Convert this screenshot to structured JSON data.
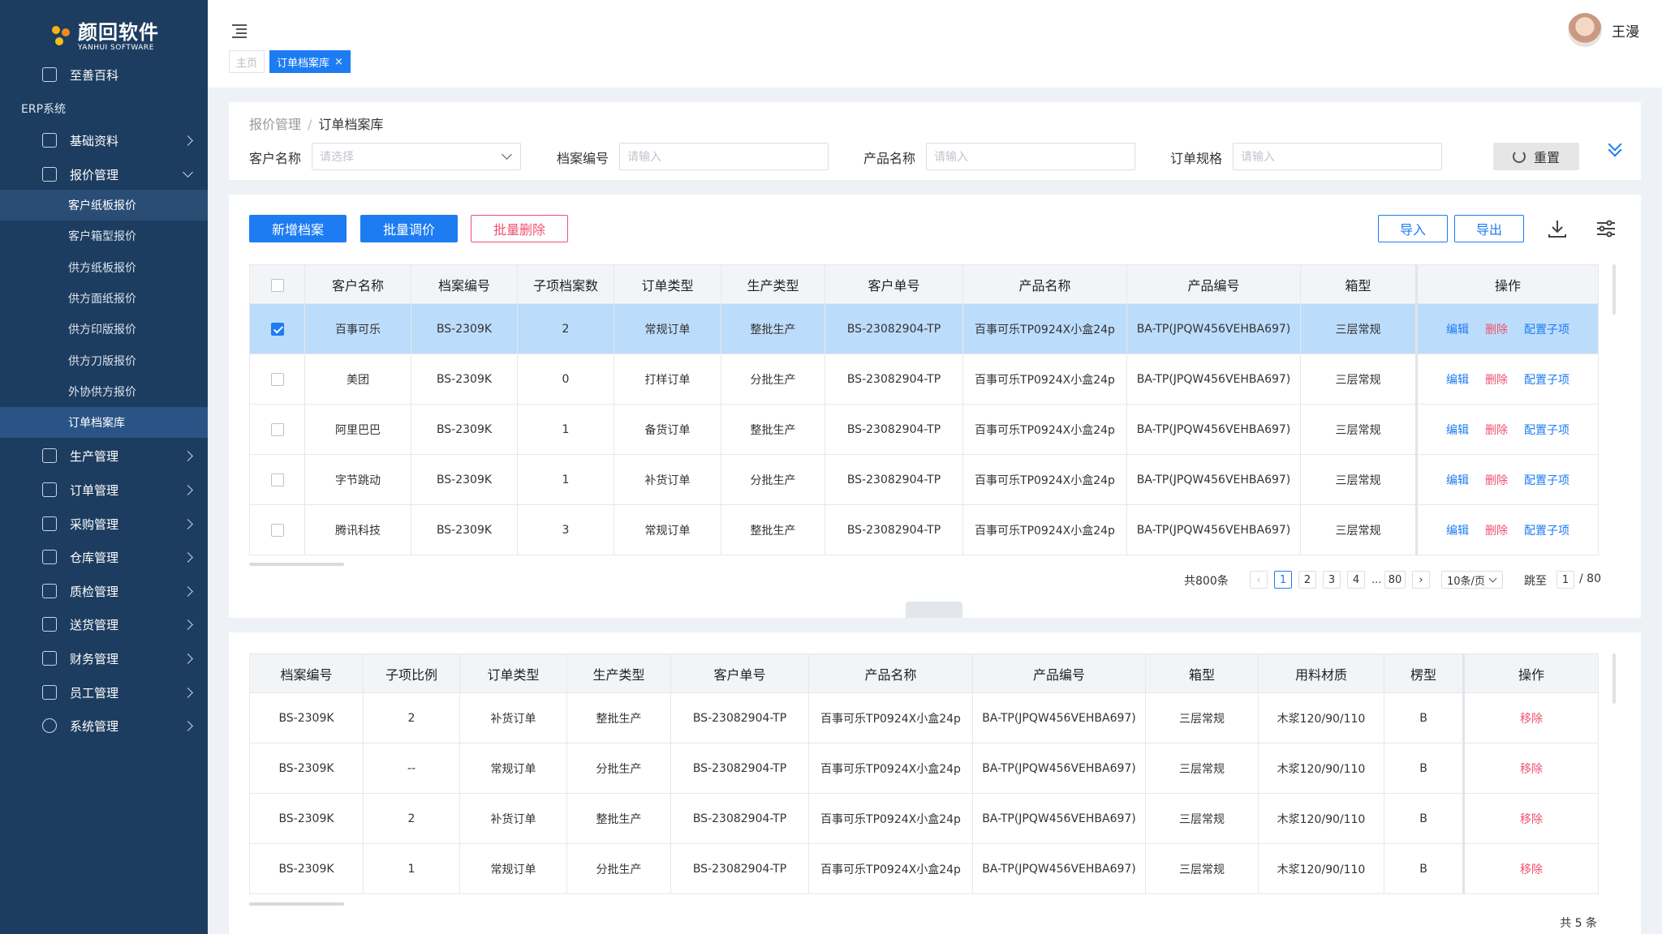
{
  "brand": {
    "name_cn": "颜回软件",
    "name_en": "YANHUI SOFTWARE"
  },
  "sidebar": {
    "top_item": "至善百科",
    "section": "ERP系统",
    "items": [
      {
        "label": "基础资料",
        "icon": "database-icon"
      },
      {
        "label": "报价管理",
        "icon": "quote-icon",
        "expanded": true
      },
      {
        "label": "生产管理",
        "icon": "factory-icon"
      },
      {
        "label": "订单管理",
        "icon": "order-icon"
      },
      {
        "label": "采购管理",
        "icon": "purchase-icon"
      },
      {
        "label": "仓库管理",
        "icon": "warehouse-icon"
      },
      {
        "label": "质检管理",
        "icon": "shield-icon"
      },
      {
        "label": "送货管理",
        "icon": "box-icon"
      },
      {
        "label": "财务管理",
        "icon": "finance-icon"
      },
      {
        "label": "员工管理",
        "icon": "staff-icon"
      },
      {
        "label": "系统管理",
        "icon": "gear-icon"
      }
    ],
    "sub_items": [
      "客户纸板报价",
      "客户箱型报价",
      "供方纸板报价",
      "供方面纸报价",
      "供方印版报价",
      "供方刀版报价",
      "外协供方报价",
      "订单档案库"
    ]
  },
  "header": {
    "tabs": [
      {
        "label": "主页"
      },
      {
        "label": "订单档案库",
        "close": "×"
      }
    ],
    "user_name": "王漫"
  },
  "filter": {
    "breadcrumb": [
      "报价管理",
      "订单档案库"
    ],
    "fields": [
      {
        "label": "客户名称",
        "placeholder": "请选择"
      },
      {
        "label": "档案编号",
        "placeholder": "请输入"
      },
      {
        "label": "产品名称",
        "placeholder": "请输入"
      },
      {
        "label": "订单规格",
        "placeholder": "请输入"
      }
    ],
    "reset": "重置"
  },
  "toolbar": {
    "add": "新增档案",
    "batch_price": "批量调价",
    "batch_delete": "批量删除",
    "import": "导入",
    "export": "导出"
  },
  "table1": {
    "headers": [
      "客户名称",
      "档案编号",
      "子项档案数",
      "订单类型",
      "生产类型",
      "客户单号",
      "产品名称",
      "产品编号",
      "箱型",
      "操作"
    ],
    "ops": [
      "编辑",
      "删除",
      "配置子项"
    ],
    "rows": [
      {
        "checked": true,
        "cells": [
          "百事可乐",
          "BS-2309K",
          "2",
          "常规订单",
          "整批生产",
          "BS-23082904-TP",
          "百事可乐TP0924X小盒24p",
          "BA-TP(JPQW456VEHBA697)",
          "三层常规"
        ]
      },
      {
        "checked": false,
        "cells": [
          "美团",
          "BS-2309K",
          "0",
          "打样订单",
          "分批生产",
          "BS-23082904-TP",
          "百事可乐TP0924X小盒24p",
          "BA-TP(JPQW456VEHBA697)",
          "三层常规"
        ]
      },
      {
        "checked": false,
        "cells": [
          "阿里巴巴",
          "BS-2309K",
          "1",
          "备货订单",
          "整批生产",
          "BS-23082904-TP",
          "百事可乐TP0924X小盒24p",
          "BA-TP(JPQW456VEHBA697)",
          "三层常规"
        ]
      },
      {
        "checked": false,
        "cells": [
          "字节跳动",
          "BS-2309K",
          "1",
          "补货订单",
          "分批生产",
          "BS-23082904-TP",
          "百事可乐TP0924X小盒24p",
          "BA-TP(JPQW456VEHBA697)",
          "三层常规"
        ]
      },
      {
        "checked": false,
        "cells": [
          "腾讯科技",
          "BS-2309K",
          "3",
          "常规订单",
          "整批生产",
          "BS-23082904-TP",
          "百事可乐TP0924X小盒24p",
          "BA-TP(JPQW456VEHBA697)",
          "三层常规"
        ]
      }
    ]
  },
  "pagination": {
    "total": "共800条",
    "pages": [
      "1",
      "2",
      "3",
      "4",
      "80"
    ],
    "ellipsis": "...",
    "page_size": "10条/页",
    "jump_label": "跳至",
    "jump_value": "1",
    "page_count": "/ 80"
  },
  "table2": {
    "headers": [
      "档案编号",
      "子项比例",
      "订单类型",
      "生产类型",
      "客户单号",
      "产品名称",
      "产品编号",
      "箱型",
      "用料材质",
      "楞型",
      "操作"
    ],
    "op": "移除",
    "rows": [
      [
        "BS-2309K",
        "2",
        "补货订单",
        "整批生产",
        "BS-23082904-TP",
        "百事可乐TP0924X小盒24p",
        "BA-TP(JPQW456VEHBA697)",
        "三层常规",
        "木浆120/90/110",
        "B"
      ],
      [
        "BS-2309K",
        "--",
        "常规订单",
        "分批生产",
        "BS-23082904-TP",
        "百事可乐TP0924X小盒24p",
        "BA-TP(JPQW456VEHBA697)",
        "三层常规",
        "木浆120/90/110",
        "B"
      ],
      [
        "BS-2309K",
        "2",
        "补货订单",
        "整批生产",
        "BS-23082904-TP",
        "百事可乐TP0924X小盒24p",
        "BA-TP(JPQW456VEHBA697)",
        "三层常规",
        "木浆120/90/110",
        "B"
      ],
      [
        "BS-2309K",
        "1",
        "常规订单",
        "分批生产",
        "BS-23082904-TP",
        "百事可乐TP0924X小盒24p",
        "BA-TP(JPQW456VEHBA697)",
        "三层常规",
        "木浆120/90/110",
        "B"
      ]
    ],
    "total": "共 5 条"
  },
  "colors": {
    "sidebar": "#1d3d60",
    "accent": "#1d7cf2",
    "danger": "#f0506e",
    "selected_row": "#bcdcfb"
  }
}
